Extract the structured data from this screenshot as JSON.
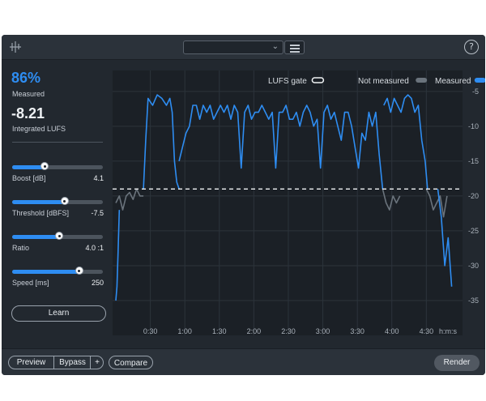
{
  "header": {
    "preset_value": "",
    "logo_icon": "izotope-logo-icon",
    "menu_icon": "hamburger-menu-icon",
    "help_icon": "question-mark-icon",
    "help_label": "?"
  },
  "stats": {
    "measured_value": "86%",
    "measured_label": "Measured",
    "integrated_value": "-8.21",
    "integrated_label": "Integrated LUFS"
  },
  "sliders": [
    {
      "label": "Boost [dB]",
      "value": "4.1",
      "level": 0.36
    },
    {
      "label": "Threshold [dBFS]",
      "value": "-7.5",
      "level": 0.58
    },
    {
      "label": "Ratio",
      "value": "4.0 :1",
      "level": 0.52
    },
    {
      "label": "Speed [ms]",
      "value": "250",
      "level": 0.74
    }
  ],
  "learn_label": "Learn",
  "bottom": {
    "preview_label": "Preview",
    "bypass_label": "Bypass",
    "plus_label": "+",
    "compare_label": "Compare",
    "render_label": "Render"
  },
  "colors": {
    "accent": "#2e8df2",
    "panel": "#22282f",
    "bar": "#2b323a",
    "not_measured": "#6a737c"
  },
  "chart_data": {
    "type": "line",
    "legend": [
      {
        "label": "LUFS gate",
        "style": "dashed-white"
      },
      {
        "label": "Not measured",
        "color": "#6a737c"
      },
      {
        "label": "Measured",
        "color": "#2e8df2"
      }
    ],
    "legend_position": "top-right",
    "y_axis": {
      "ticks": [
        "-5",
        "-10",
        "-15",
        "-20",
        "-25",
        "-30",
        "-35"
      ],
      "range": [
        -2,
        -40
      ]
    },
    "x_axis": {
      "ticks": [
        "0:30",
        "1:00",
        "1:30",
        "2:00",
        "2:30",
        "3:00",
        "3:30",
        "4:00",
        "4:30"
      ],
      "unit_label": "h:m:s",
      "range_seconds": [
        0,
        293
      ]
    },
    "gate_lufs": -19,
    "series": [
      {
        "name": "Not measured",
        "segments": [
          {
            "x": [
              0,
              3,
              6,
              9,
              12,
              15,
              18,
              21,
              24
            ],
            "y": [
              -21,
              -20,
              -22,
              -20,
              -19.5,
              -20.5,
              -19,
              -20,
              -20
            ]
          },
          {
            "x": [
              232,
              235,
              238,
              241,
              244,
              247
            ],
            "y": [
              -19,
              -21,
              -22,
              -20,
              -21,
              -20
            ]
          },
          {
            "x": [
              270,
              273,
              276,
              279,
              282,
              285,
              288
            ],
            "y": [
              -19,
              -20,
              -22,
              -21,
              -20,
              -23,
              -20
            ]
          }
        ]
      },
      {
        "name": "Measured",
        "segments": [
          {
            "x": [
              0,
              1,
              2,
              3
            ],
            "y": [
              -35,
              -33,
              -28,
              -22
            ]
          },
          {
            "x": [
              24,
              26,
              28,
              32,
              36,
              40,
              44,
              47,
              49,
              51,
              53,
              55
            ],
            "y": [
              -19,
              -12,
              -6,
              -7,
              -5.5,
              -6,
              -7,
              -6,
              -8,
              -15,
              -18,
              -19
            ]
          },
          {
            "x": [
              55,
              58,
              61,
              64,
              67,
              70,
              73,
              76,
              79,
              82,
              85,
              88,
              91,
              94,
              97,
              100,
              103,
              106,
              109,
              112,
              115,
              118,
              121,
              124,
              127,
              130,
              133,
              136,
              139,
              142,
              145,
              148,
              151,
              154,
              157,
              160,
              163,
              166,
              169,
              172,
              175,
              178,
              181,
              184,
              187,
              190,
              193,
              196,
              199,
              202,
              205,
              208,
              211,
              214,
              217,
              220,
              223,
              226,
              229,
              232
            ],
            "y": [
              -15,
              -13,
              -11,
              -10,
              -7,
              -7,
              -9,
              -7,
              -8,
              -7,
              -9,
              -8,
              -7,
              -8,
              -7,
              -9,
              -7,
              -8,
              -16,
              -8,
              -7,
              -9,
              -8,
              -8,
              -7,
              -8,
              -9,
              -8,
              -16,
              -8,
              -8,
              -7,
              -9,
              -9,
              -8,
              -10,
              -8,
              -7,
              -8,
              -10,
              -9,
              -16,
              -8,
              -7,
              -9,
              -8,
              -10,
              -12,
              -8,
              -8,
              -10,
              -13,
              -16,
              -11,
              -12,
              -8,
              -10,
              -8,
              -14,
              -19
            ]
          },
          {
            "x": [
              233,
              236,
              239,
              242,
              245,
              248,
              251,
              254,
              257,
              260,
              263,
              266,
              269,
              271
            ],
            "y": [
              -7,
              -6,
              -8,
              -6,
              -7,
              -8,
              -6,
              -5.5,
              -6,
              -8,
              -7,
              -12,
              -15,
              -19
            ]
          },
          {
            "x": [
              280,
              283,
              286,
              289,
              292
            ],
            "y": [
              -19,
              -23,
              -30,
              -26,
              -33
            ]
          }
        ]
      }
    ]
  }
}
